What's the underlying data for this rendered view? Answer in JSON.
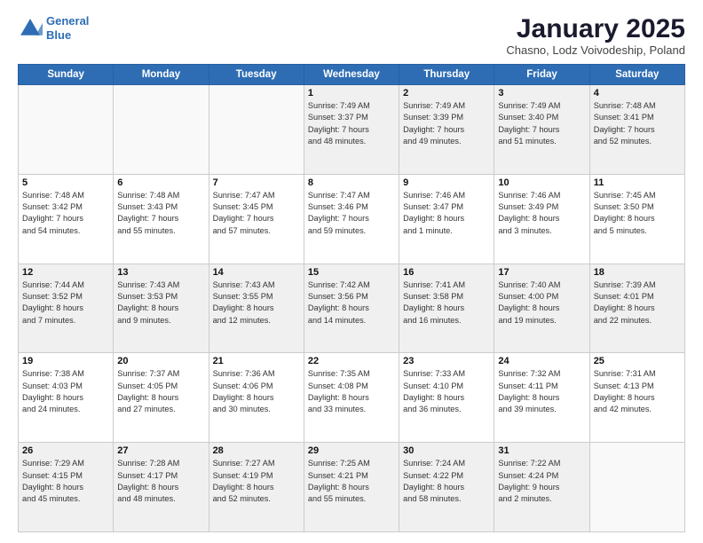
{
  "logo": {
    "line1": "General",
    "line2": "Blue"
  },
  "header": {
    "month": "January 2025",
    "location": "Chasno, Lodz Voivodeship, Poland"
  },
  "days_of_week": [
    "Sunday",
    "Monday",
    "Tuesday",
    "Wednesday",
    "Thursday",
    "Friday",
    "Saturday"
  ],
  "weeks": [
    [
      {
        "day": "",
        "info": ""
      },
      {
        "day": "",
        "info": ""
      },
      {
        "day": "",
        "info": ""
      },
      {
        "day": "1",
        "info": "Sunrise: 7:49 AM\nSunset: 3:37 PM\nDaylight: 7 hours\nand 48 minutes."
      },
      {
        "day": "2",
        "info": "Sunrise: 7:49 AM\nSunset: 3:39 PM\nDaylight: 7 hours\nand 49 minutes."
      },
      {
        "day": "3",
        "info": "Sunrise: 7:49 AM\nSunset: 3:40 PM\nDaylight: 7 hours\nand 51 minutes."
      },
      {
        "day": "4",
        "info": "Sunrise: 7:48 AM\nSunset: 3:41 PM\nDaylight: 7 hours\nand 52 minutes."
      }
    ],
    [
      {
        "day": "5",
        "info": "Sunrise: 7:48 AM\nSunset: 3:42 PM\nDaylight: 7 hours\nand 54 minutes."
      },
      {
        "day": "6",
        "info": "Sunrise: 7:48 AM\nSunset: 3:43 PM\nDaylight: 7 hours\nand 55 minutes."
      },
      {
        "day": "7",
        "info": "Sunrise: 7:47 AM\nSunset: 3:45 PM\nDaylight: 7 hours\nand 57 minutes."
      },
      {
        "day": "8",
        "info": "Sunrise: 7:47 AM\nSunset: 3:46 PM\nDaylight: 7 hours\nand 59 minutes."
      },
      {
        "day": "9",
        "info": "Sunrise: 7:46 AM\nSunset: 3:47 PM\nDaylight: 8 hours\nand 1 minute."
      },
      {
        "day": "10",
        "info": "Sunrise: 7:46 AM\nSunset: 3:49 PM\nDaylight: 8 hours\nand 3 minutes."
      },
      {
        "day": "11",
        "info": "Sunrise: 7:45 AM\nSunset: 3:50 PM\nDaylight: 8 hours\nand 5 minutes."
      }
    ],
    [
      {
        "day": "12",
        "info": "Sunrise: 7:44 AM\nSunset: 3:52 PM\nDaylight: 8 hours\nand 7 minutes."
      },
      {
        "day": "13",
        "info": "Sunrise: 7:43 AM\nSunset: 3:53 PM\nDaylight: 8 hours\nand 9 minutes."
      },
      {
        "day": "14",
        "info": "Sunrise: 7:43 AM\nSunset: 3:55 PM\nDaylight: 8 hours\nand 12 minutes."
      },
      {
        "day": "15",
        "info": "Sunrise: 7:42 AM\nSunset: 3:56 PM\nDaylight: 8 hours\nand 14 minutes."
      },
      {
        "day": "16",
        "info": "Sunrise: 7:41 AM\nSunset: 3:58 PM\nDaylight: 8 hours\nand 16 minutes."
      },
      {
        "day": "17",
        "info": "Sunrise: 7:40 AM\nSunset: 4:00 PM\nDaylight: 8 hours\nand 19 minutes."
      },
      {
        "day": "18",
        "info": "Sunrise: 7:39 AM\nSunset: 4:01 PM\nDaylight: 8 hours\nand 22 minutes."
      }
    ],
    [
      {
        "day": "19",
        "info": "Sunrise: 7:38 AM\nSunset: 4:03 PM\nDaylight: 8 hours\nand 24 minutes."
      },
      {
        "day": "20",
        "info": "Sunrise: 7:37 AM\nSunset: 4:05 PM\nDaylight: 8 hours\nand 27 minutes."
      },
      {
        "day": "21",
        "info": "Sunrise: 7:36 AM\nSunset: 4:06 PM\nDaylight: 8 hours\nand 30 minutes."
      },
      {
        "day": "22",
        "info": "Sunrise: 7:35 AM\nSunset: 4:08 PM\nDaylight: 8 hours\nand 33 minutes."
      },
      {
        "day": "23",
        "info": "Sunrise: 7:33 AM\nSunset: 4:10 PM\nDaylight: 8 hours\nand 36 minutes."
      },
      {
        "day": "24",
        "info": "Sunrise: 7:32 AM\nSunset: 4:11 PM\nDaylight: 8 hours\nand 39 minutes."
      },
      {
        "day": "25",
        "info": "Sunrise: 7:31 AM\nSunset: 4:13 PM\nDaylight: 8 hours\nand 42 minutes."
      }
    ],
    [
      {
        "day": "26",
        "info": "Sunrise: 7:29 AM\nSunset: 4:15 PM\nDaylight: 8 hours\nand 45 minutes."
      },
      {
        "day": "27",
        "info": "Sunrise: 7:28 AM\nSunset: 4:17 PM\nDaylight: 8 hours\nand 48 minutes."
      },
      {
        "day": "28",
        "info": "Sunrise: 7:27 AM\nSunset: 4:19 PM\nDaylight: 8 hours\nand 52 minutes."
      },
      {
        "day": "29",
        "info": "Sunrise: 7:25 AM\nSunset: 4:21 PM\nDaylight: 8 hours\nand 55 minutes."
      },
      {
        "day": "30",
        "info": "Sunrise: 7:24 AM\nSunset: 4:22 PM\nDaylight: 8 hours\nand 58 minutes."
      },
      {
        "day": "31",
        "info": "Sunrise: 7:22 AM\nSunset: 4:24 PM\nDaylight: 9 hours\nand 2 minutes."
      },
      {
        "day": "",
        "info": ""
      }
    ]
  ],
  "colors": {
    "header_bg": "#2e6db4",
    "row_shaded": "#f0f0f0",
    "row_white": "#ffffff"
  }
}
